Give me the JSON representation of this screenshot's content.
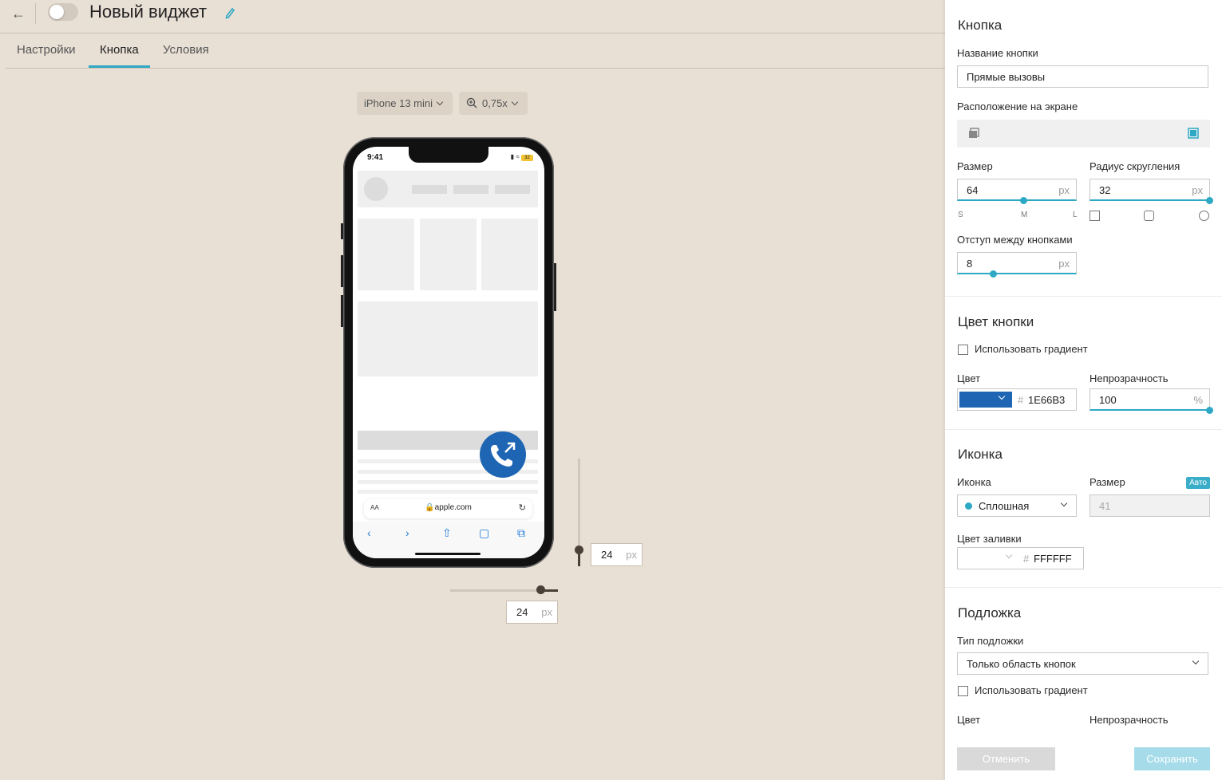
{
  "header": {
    "back_icon": "arrow-left-icon",
    "toggle_on": false,
    "title": "Новый виджет",
    "edit_icon": "pencil-icon"
  },
  "tabs": [
    {
      "label": "Настройки",
      "active": false
    },
    {
      "label": "Кнопка",
      "active": true
    },
    {
      "label": "Условия",
      "active": false
    }
  ],
  "preview": {
    "device": "iPhone 13 mini",
    "zoom": "0,75x",
    "phone": {
      "time": "9:41",
      "battery": "32",
      "address_aa": "AA",
      "address_url": "apple.com"
    },
    "vertical_offset": {
      "value": "24",
      "unit": "px"
    },
    "horizontal_offset": {
      "value": "24",
      "unit": "px"
    },
    "button_color": "#1e66b3"
  },
  "panel": {
    "button_section": {
      "heading": "Кнопка",
      "name_label": "Название кнопки",
      "name_value": "Прямые вызовы",
      "position_label": "Расположение на экране",
      "size_label": "Размер",
      "size_value": "64",
      "size_unit": "px",
      "size_ticks": [
        "S",
        "M",
        "L"
      ],
      "radius_label": "Радиус скругления",
      "radius_value": "32",
      "radius_unit": "px",
      "gap_label": "Отступ между кнопками",
      "gap_value": "8",
      "gap_unit": "px"
    },
    "color_section": {
      "heading": "Цвет кнопки",
      "gradient_label": "Использовать градиент",
      "color_label": "Цвет",
      "hash": "#",
      "color_hex": "1E66B3",
      "swatch_color": "#1e66b3",
      "opacity_label": "Непрозрачность",
      "opacity_value": "100",
      "opacity_unit": "%"
    },
    "icon_section": {
      "heading": "Иконка",
      "icon_label": "Иконка",
      "icon_value": "Сплошная",
      "size_label": "Размер",
      "auto_badge": "Авто",
      "size_value": "41",
      "fill_label": "Цвет заливки",
      "hash": "#",
      "fill_hex": "FFFFFF"
    },
    "backdrop_section": {
      "heading": "Подложка",
      "type_label": "Тип подложки",
      "type_value": "Только область кнопок",
      "gradient_label": "Использовать градиент",
      "color_label": "Цвет",
      "opacity_label": "Непрозрачность"
    },
    "footer": {
      "cancel_label": "Отменить",
      "save_label": "Сохранить"
    }
  }
}
